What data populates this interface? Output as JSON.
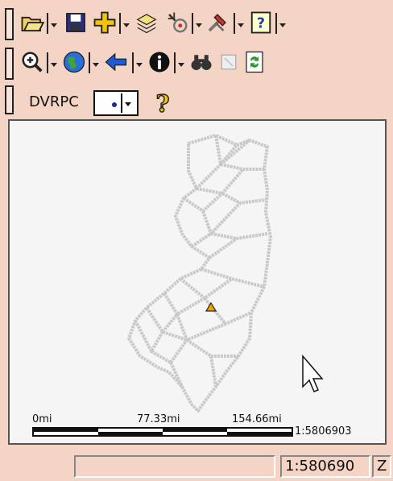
{
  "toolbar1": {
    "icons": [
      "open-folder-icon",
      "save-icon",
      "add-data-icon",
      "layers-icon",
      "identify-location-icon",
      "tools-icon",
      "help-icon"
    ]
  },
  "toolbar2": {
    "icons": [
      "zoom-in-icon",
      "globe-icon",
      "back-arrow-icon",
      "info-icon",
      "find-binoculars-icon",
      "disabled-select-icon",
      "refresh-icon"
    ]
  },
  "layer_toolbar": {
    "layer_name": "DVRPC",
    "help_icon": "question-mark-icon"
  },
  "map": {
    "scale_bar": {
      "label_start": "0mi",
      "label_mid": "77.33mi",
      "label_end": "154.66mi",
      "ratio_label": "1:5806903"
    },
    "marker_color": "#f2a500",
    "county_outline_color": "#c9c9c9"
  },
  "status_bar": {
    "scale_value": "1:580690",
    "extra_label": "Z"
  }
}
